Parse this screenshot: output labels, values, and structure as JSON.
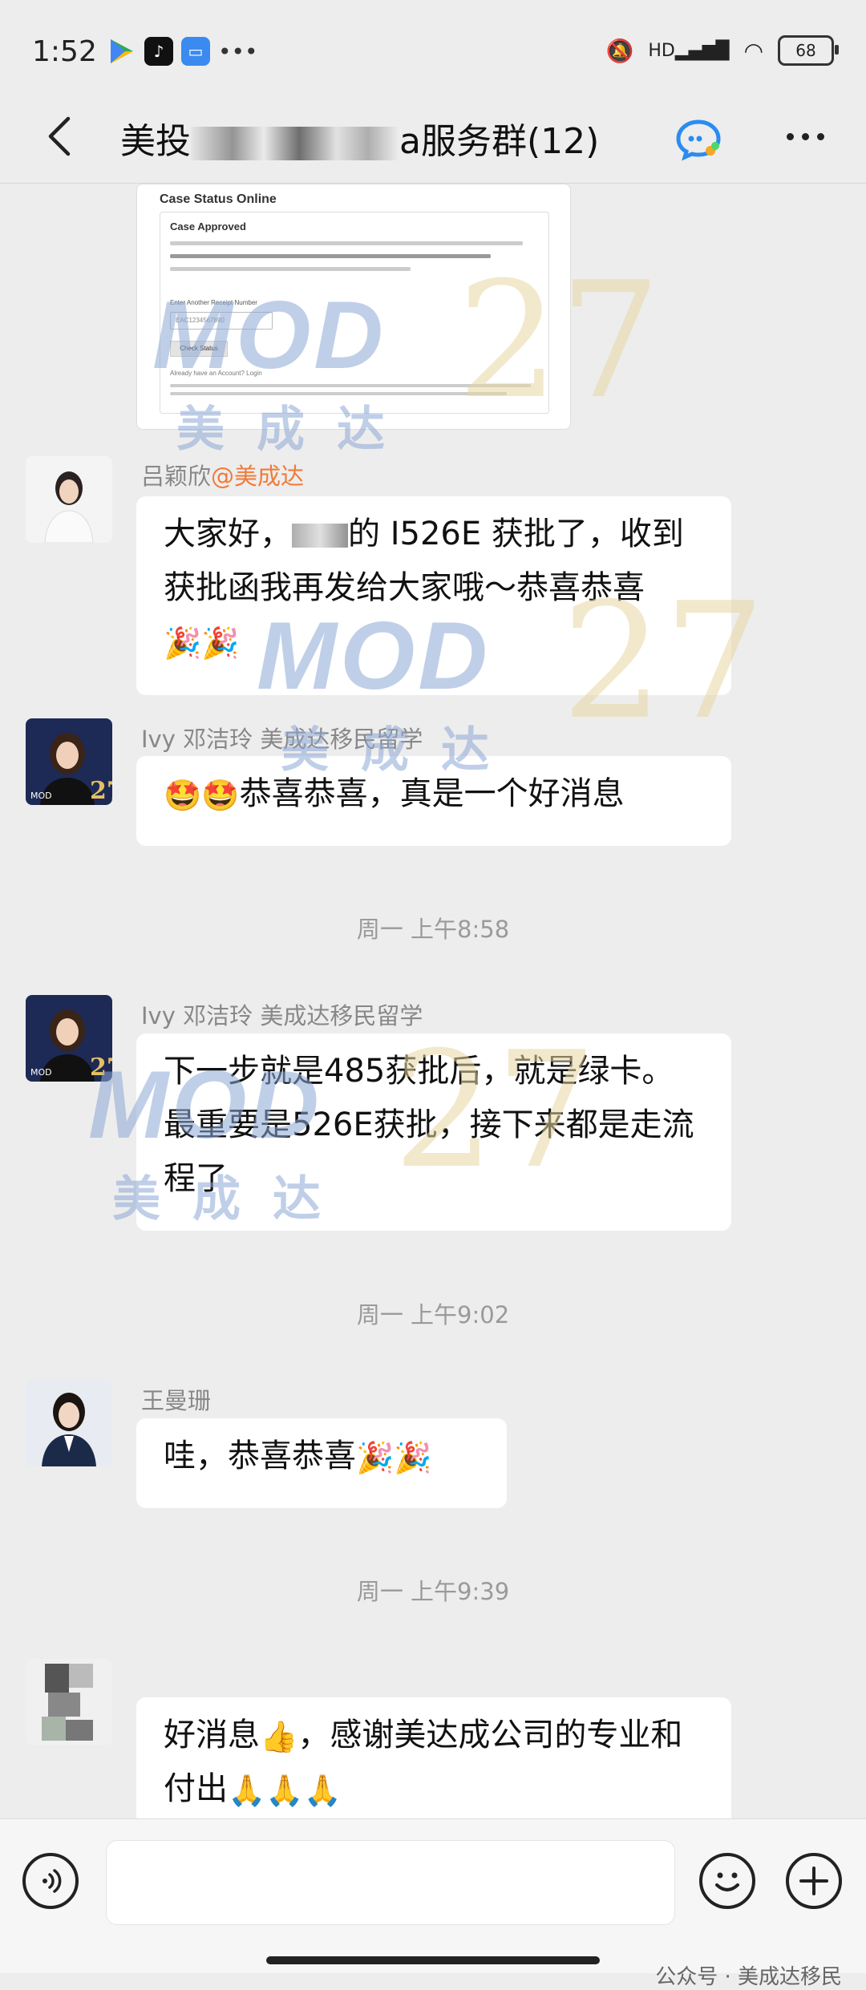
{
  "status_bar": {
    "time": "1:52",
    "battery": "68",
    "network": "HD"
  },
  "header": {
    "title_prefix": "美投",
    "title_suffix": "a服务群(12)"
  },
  "image_message": {
    "title": "Case Status Online",
    "card_title": "Case Approved",
    "field_label": "Enter Another Receipt Number",
    "field_placeholder": "EAC1234567890",
    "button_label": "Check Status",
    "link_text": "Already have an Account? Login"
  },
  "messages": [
    {
      "sender": "吕颖欣",
      "sender_tag": "@美成达",
      "text_a": "大家好，",
      "text_b": "的 I526E 获批了，收到获批函我再发给大家哦～恭喜恭喜",
      "emojis": "🎉🎉"
    },
    {
      "sender": "Ivy 邓洁玲 美成达移民留学",
      "emojis": "🤩🤩",
      "text": "恭喜恭喜，真是一个好消息"
    },
    {
      "timestamp": "周一 上午8:58"
    },
    {
      "sender": "Ivy 邓洁玲 美成达移民留学",
      "text": "下一步就是485获批后，就是绿卡。最重要是526E获批，接下来都是走流程了"
    },
    {
      "timestamp": "周一 上午9:02"
    },
    {
      "sender": "王曼珊",
      "text": "哇，恭喜恭喜",
      "emojis": "🎉🎉"
    },
    {
      "timestamp": "周一 上午9:39"
    },
    {
      "text_a": "好消息",
      "emoji_a": "👍",
      "text_b": "，感谢美达成公司的专业和付出",
      "emojis": "🙏🙏🙏"
    }
  ],
  "watermark": {
    "brand": "MOD",
    "brand_cn": "美成达",
    "number": "27"
  },
  "footer": {
    "credit": "公众号 · 美成达移民"
  }
}
